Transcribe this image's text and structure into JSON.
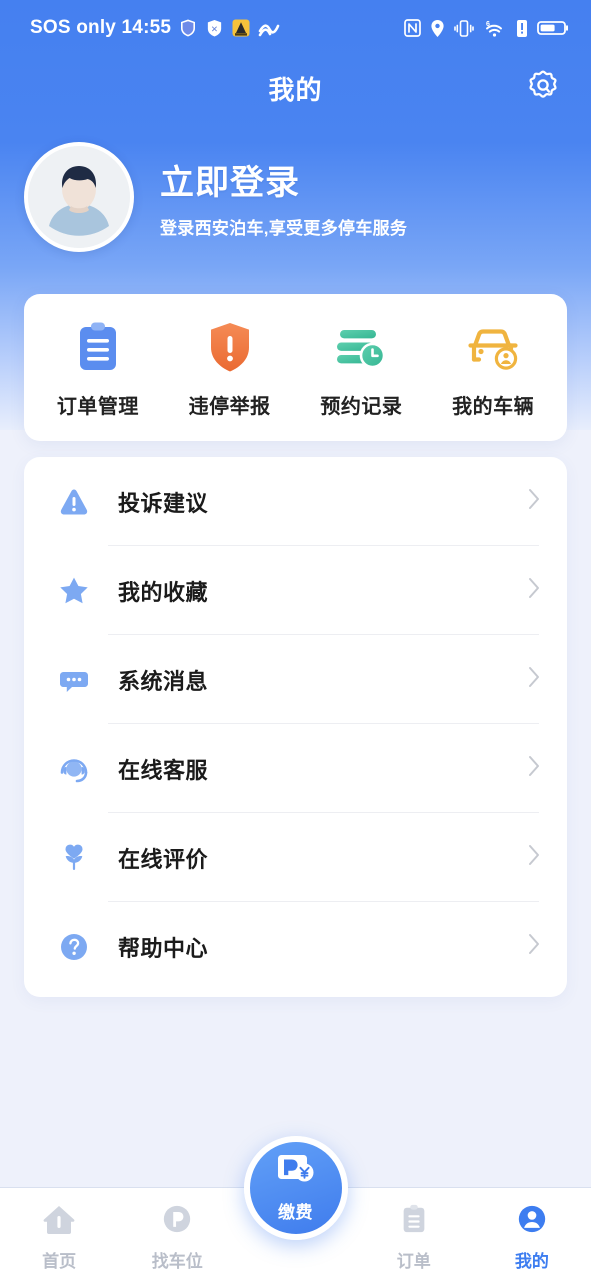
{
  "statusbar": {
    "carrier_time": "SOS only 14:55",
    "left_icons": [
      "shield-app-icon",
      "bug-app-icon",
      "warning-app-icon",
      "wave-app-icon"
    ],
    "right_icons": [
      "nfc-icon",
      "location-icon",
      "vibrate-icon",
      "wifi6-icon",
      "alert-icon",
      "battery-icon"
    ]
  },
  "header": {
    "title": "我的",
    "settings_icon": "gear-icon"
  },
  "profile": {
    "login_title": "立即登录",
    "login_subtitle": "登录西安泊车,享受更多停车服务",
    "avatar_icon": "default-user-avatar"
  },
  "quick_actions": [
    {
      "label": "订单管理",
      "icon": "clipboard-icon",
      "color": "#5b8def"
    },
    {
      "label": "违停举报",
      "icon": "shield-alert-icon",
      "color": "#f0793f"
    },
    {
      "label": "预约记录",
      "icon": "list-clock-icon",
      "color": "#4cc3a0"
    },
    {
      "label": "我的车辆",
      "icon": "car-user-icon",
      "color": "#f0b43f"
    }
  ],
  "menu": [
    {
      "label": "投诉建议",
      "icon": "warning-triangle-icon",
      "chevron": "›"
    },
    {
      "label": "我的收藏",
      "icon": "star-icon",
      "chevron": "›"
    },
    {
      "label": "系统消息",
      "icon": "chat-bubble-icon",
      "chevron": "›"
    },
    {
      "label": "在线客服",
      "icon": "headset-icon",
      "chevron": "›"
    },
    {
      "label": "在线评价",
      "icon": "heart-flower-icon",
      "chevron": "›"
    },
    {
      "label": "帮助中心",
      "icon": "question-circle-icon",
      "chevron": "›"
    }
  ],
  "tabbar": {
    "items": [
      {
        "label": "首页",
        "icon": "home-icon",
        "active": false
      },
      {
        "label": "找车位",
        "icon": "parking-p-icon",
        "active": false
      },
      {
        "label": "订单",
        "icon": "clipboard-icon",
        "active": false
      },
      {
        "label": "我的",
        "icon": "person-icon",
        "active": true
      }
    ],
    "fab": {
      "label": "缴费",
      "icon": "parking-pay-icon"
    }
  },
  "colors": {
    "brand_blue": "#4580f0",
    "active_blue": "#3d7df0",
    "page_bg": "#eef1fb",
    "card_bg": "#ffffff",
    "inactive_gray": "#b9bec9"
  }
}
